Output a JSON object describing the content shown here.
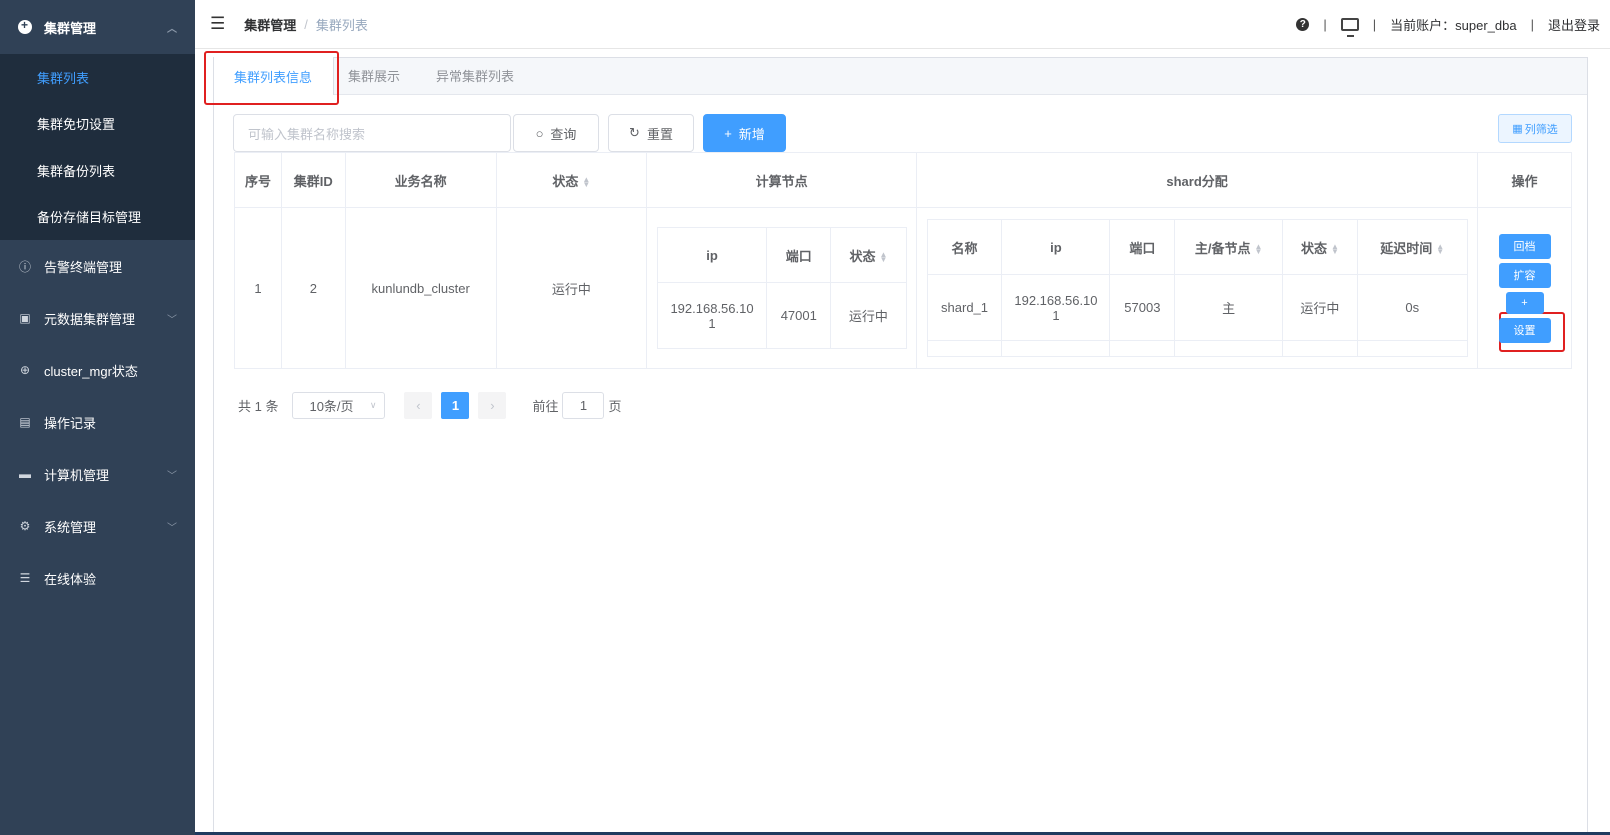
{
  "sidebar": {
    "group": {
      "label": "集群管理",
      "icon": "plus-circle-icon"
    },
    "subitems": [
      {
        "label": "集群列表",
        "active": true
      },
      {
        "label": "集群免切设置",
        "active": false
      },
      {
        "label": "集群备份列表",
        "active": false
      },
      {
        "label": "备份存储目标管理",
        "active": false
      }
    ],
    "items": [
      {
        "label": "告警终端管理",
        "icon": "alert-icon"
      },
      {
        "label": "元数据集群管理",
        "icon": "metadata-icon"
      },
      {
        "label": "cluster_mgr状态",
        "icon": "status-icon"
      },
      {
        "label": "操作记录",
        "icon": "record-icon"
      },
      {
        "label": "计算机管理",
        "icon": "computer-icon"
      },
      {
        "label": "系统管理",
        "icon": "settings-icon"
      },
      {
        "label": "在线体验",
        "icon": "database-icon"
      }
    ]
  },
  "header": {
    "breadcrumb": [
      "集群管理",
      "集群列表"
    ],
    "help": "?",
    "account_label": "当前账户：super_dba",
    "logout": "退出登录"
  },
  "tabs": [
    {
      "label": "集群列表信息",
      "active": true
    },
    {
      "label": "集群展示",
      "active": false
    },
    {
      "label": "异常集群列表",
      "active": false
    }
  ],
  "toolbar": {
    "search_placeholder": "可输入集群名称搜索",
    "query": "查询",
    "reset": "重置",
    "add": "新增",
    "column_filter": "列筛选"
  },
  "table": {
    "headers": {
      "index": "序号",
      "cluster_id": "集群ID",
      "name": "业务名称",
      "status": "状态",
      "compute": "计算节点",
      "shard": "shard分配",
      "ops": "操作"
    },
    "compute_headers": {
      "ip": "ip",
      "port": "端口",
      "status": "状态"
    },
    "shard_headers": {
      "name": "名称",
      "ip": "ip",
      "port": "端口",
      "role": "主/备节点",
      "status": "状态",
      "delay": "延迟时间"
    },
    "row": {
      "index": "1",
      "cluster_id": "2",
      "name": "kunlundb_cluster",
      "status": "运行中",
      "compute": {
        "ip_line1": "192.168.56.10",
        "ip_line2": "1",
        "port": "47001",
        "status": "运行中"
      },
      "shard": {
        "name": "shard_1",
        "ip_line1": "192.168.56.10",
        "ip_line2": "1",
        "port": "57003",
        "role": "主",
        "status": "运行中",
        "delay": "0s"
      },
      "ops": {
        "rollback": "回档",
        "expand": "扩容",
        "plus": "+",
        "settings": "设置"
      }
    }
  },
  "pagination": {
    "total": "共 1 条",
    "page_size": "10条/页",
    "current": "1",
    "goto_label": "前往",
    "goto_value": "1",
    "page_suffix": "页"
  },
  "colors": {
    "sidebar_bg": "#304156",
    "submenu_bg": "#1f2d3d",
    "primary": "#409eff",
    "success": "#67c23a",
    "highlight_box": "#e02020"
  }
}
